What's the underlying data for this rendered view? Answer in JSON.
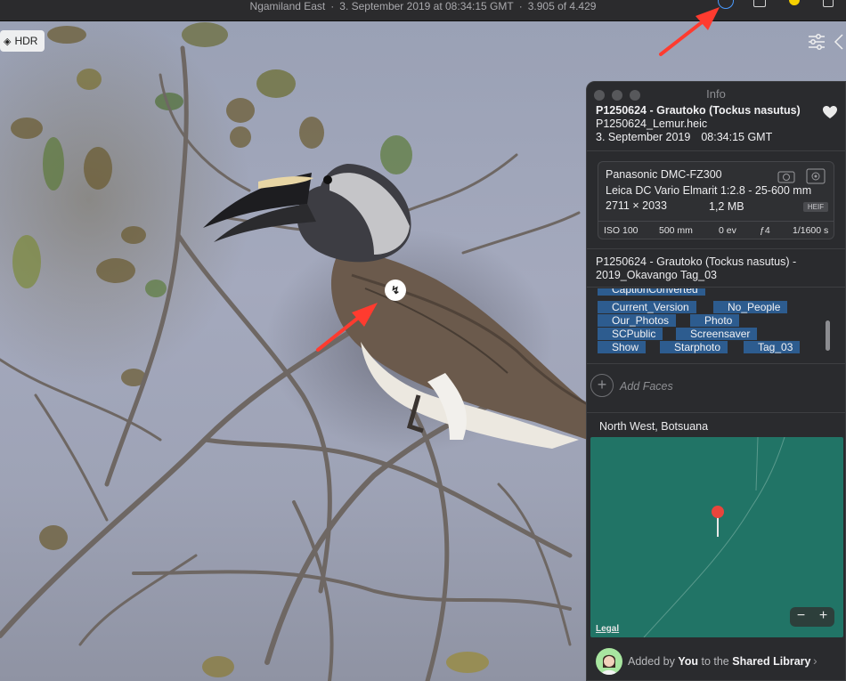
{
  "titlebar": {
    "location": "Ngamiland East",
    "datetime": "3. September 2019 at 08:34:15 GMT",
    "position": "3.905 of 4.429",
    "icons": [
      "info-icon",
      "share-icon",
      "favorite-icon",
      "delete-icon"
    ]
  },
  "photo": {
    "hdr_label": "HDR",
    "focus_glyph": "↯"
  },
  "info_panel": {
    "title": "Info",
    "photo_title": "P1250624 - Grautoko (Tockus nasutus)",
    "filename": "P1250624_Lemur.heic",
    "date": "3. September 2019",
    "time": "08:34:15 GMT",
    "camera": "Panasonic DMC-FZ300",
    "lens": "Leica DC Vario Elmarit 1:2.8 - 25-600 mm",
    "dimensions": "2711 × 2033",
    "filesize": "1,2 MB",
    "format": "HEIF",
    "exif": {
      "iso": "ISO 100",
      "focal": "500 mm",
      "exposure_comp": "0 ev",
      "aperture": "ƒ4",
      "shutter": "1/1600 s"
    },
    "caption": "P1250624 - Grautoko (Tockus nasutus) - 2019_Okavango Tag_03",
    "keywords": [
      "CaptionConverted",
      "Current_Version",
      "No_People",
      "Our_Photos",
      "Photo",
      "SCPublic",
      "Screensaver",
      "Show",
      "Starphoto",
      "Tag_03"
    ],
    "add_faces_label": "Add Faces",
    "location": "North West, Botsuana",
    "map_legal": "Legal",
    "zoom_out": "−",
    "zoom_in": "+",
    "shared": {
      "prefix": "Added by",
      "user": "You",
      "middle": "to the",
      "library": "Shared Library"
    }
  },
  "colors": {
    "keyword_bg": "#2d5c8f",
    "map_bg": "#217466",
    "pin": "#e8453c",
    "annotation_arrow": "#ff3b2f",
    "favorite": "#f5d000",
    "info_active": "#4a9bff"
  }
}
